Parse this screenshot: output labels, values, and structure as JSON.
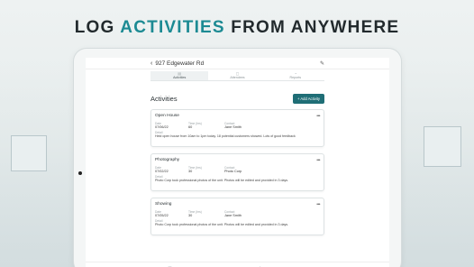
{
  "headline": {
    "part1": "LOG ",
    "accent": "ACTIVITIES",
    "part2": " FROM ANYWHERE"
  },
  "topbar": {
    "back_icon": "‹",
    "title": "927 Edgewater Rd",
    "edit_icon": "✎"
  },
  "tabs": [
    {
      "icon": "▤",
      "label": "Activities",
      "active": true
    },
    {
      "icon": "▢",
      "label": "Attendees",
      "active": false
    },
    {
      "icon": "◔",
      "label": "Reports",
      "active": false
    }
  ],
  "section": {
    "title": "Activities",
    "add_label": "+ Add Activity"
  },
  "labels": {
    "date": "Date",
    "time": "Time (hrs)",
    "contact": "Contact",
    "detail": "Detail",
    "more": "•••"
  },
  "cards": [
    {
      "title": "Open House",
      "date": "07/06/22",
      "time": "60",
      "contact": "Jane Smith",
      "detail": "Held open house from 10am to 1pm today. 18 potential customers showed. Lots of good feedback"
    },
    {
      "title": "Photography",
      "date": "07/02/22",
      "time": "30",
      "contact": "Photo Corp",
      "detail": "Photo Corp took professional photos of the unit. Photos will be edited and provided in 3 days."
    },
    {
      "title": "Showing",
      "date": "07/05/22",
      "time": "30",
      "contact": "Jane Smith",
      "detail": "Photo Corp took professional photos of the unit. Photos will be edited and provided in 3 days."
    }
  ],
  "bottom_nav": [
    {
      "icon": "▤",
      "active": false
    },
    {
      "icon": "⌂",
      "active": true
    },
    {
      "icon": "◉",
      "active": false
    },
    {
      "icon": "☺",
      "active": false
    }
  ],
  "colors": {
    "accent": "#1c8a93",
    "button": "#1f6e76"
  }
}
